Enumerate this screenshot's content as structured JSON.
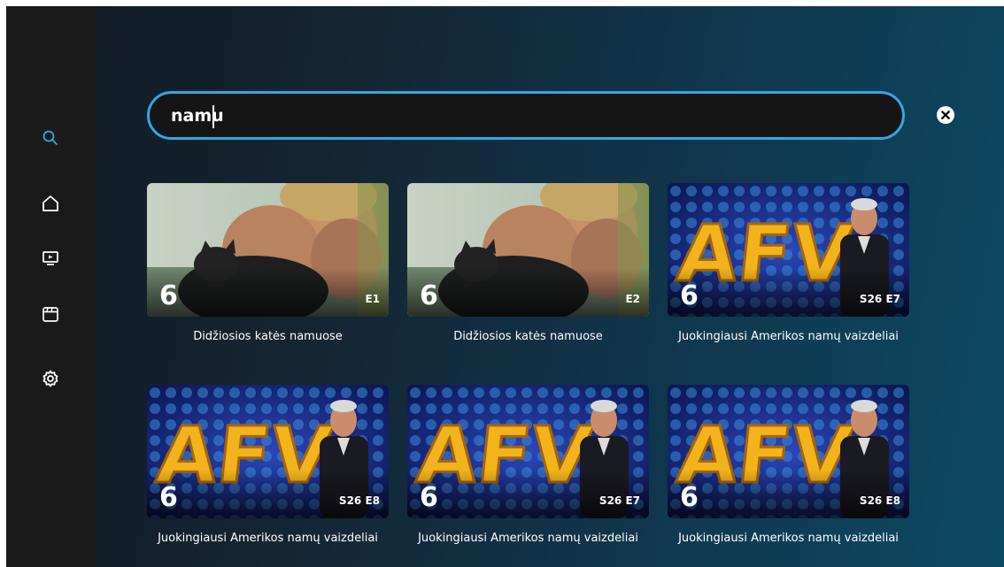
{
  "sidebar": {
    "items": [
      {
        "name": "search",
        "icon": "search-icon",
        "active": true
      },
      {
        "name": "home",
        "icon": "home-icon"
      },
      {
        "name": "tv",
        "icon": "tv-icon"
      },
      {
        "name": "movies",
        "icon": "clapperboard-icon"
      },
      {
        "name": "settings",
        "icon": "gear-icon"
      }
    ]
  },
  "search": {
    "value": "namu",
    "clear_icon": "close-circle-icon"
  },
  "colors": {
    "accent": "#2ea8e4",
    "sidebar_bg": "#1a1a1a"
  },
  "results": [
    {
      "channel": "6",
      "episode": "E1",
      "title": "Didžiosios katės namuose",
      "image": "man-with-black-cat"
    },
    {
      "channel": "6",
      "episode": "E2",
      "title": "Didžiosios katės namuose",
      "image": "man-with-black-cat"
    },
    {
      "channel": "6",
      "episode": "S26 E7",
      "title": "Juokingiausi Amerikos namų vaizdeliai",
      "image": "afv-host"
    },
    {
      "channel": "6",
      "episode": "S26 E8",
      "title": "Juokingiausi Amerikos namų vaizdeliai",
      "image": "afv-host"
    },
    {
      "channel": "6",
      "episode": "S26 E7",
      "title": "Juokingiausi Amerikos namų vaizdeliai",
      "image": "afv-host"
    },
    {
      "channel": "6",
      "episode": "S26 E8",
      "title": "Juokingiausi Amerikos namų vaizdeliai",
      "image": "afv-host"
    }
  ]
}
